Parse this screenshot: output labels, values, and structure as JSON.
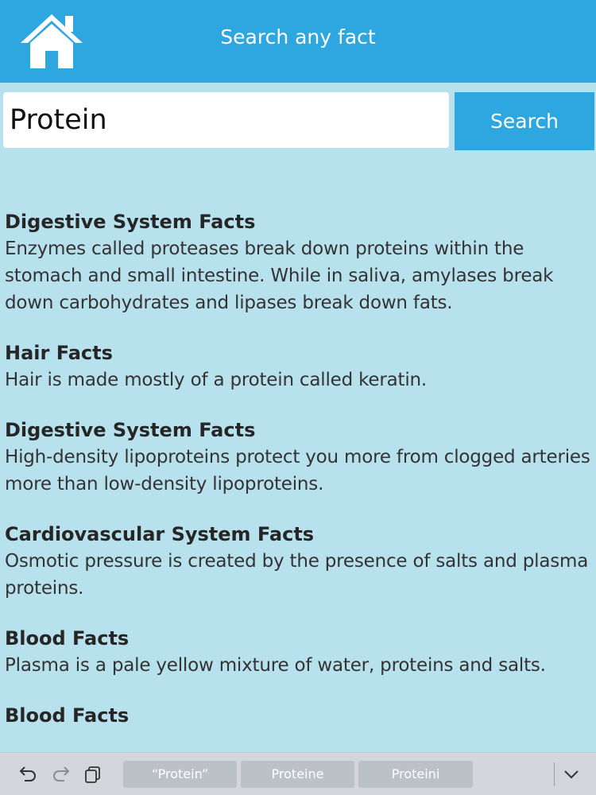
{
  "header": {
    "title": "Search any fact",
    "home_icon": "home-icon"
  },
  "search": {
    "value": "Protein",
    "button_label": "Search"
  },
  "results": [
    {
      "title": "Digestive System Facts",
      "text": "Enzymes called proteases break down proteins within the stomach and small intestine. While in saliva, amylases break down carbohydrates and lipases break down fats."
    },
    {
      "title": "Hair Facts",
      "text": "Hair is made mostly of a protein called keratin."
    },
    {
      "title": "Digestive System Facts",
      "text": "High-density lipoproteins protect you more from clogged arteries more than low-density lipoproteins."
    },
    {
      "title": "Cardiovascular System Facts",
      "text": "Osmotic pressure is created by the presence of salts and plasma proteins."
    },
    {
      "title": "Blood Facts",
      "text": "Plasma is a pale yellow mixture of water, proteins and salts."
    },
    {
      "title": "Blood Facts",
      "text": ""
    }
  ],
  "keyboard_bar": {
    "icons": [
      "undo-icon",
      "redo-icon",
      "paste-icon",
      "chevron-down-icon"
    ],
    "suggestions": [
      "“Protein”",
      "Proteine",
      "Proteini"
    ]
  },
  "colors": {
    "header": "#2ea6e0",
    "background": "#b8e1ee",
    "button": "#2ea6e0"
  }
}
